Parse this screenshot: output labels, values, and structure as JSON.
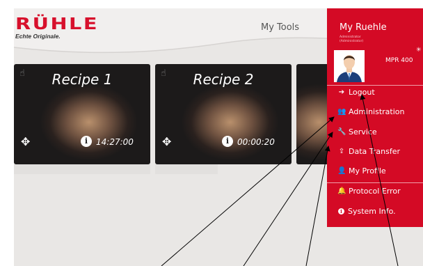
{
  "brand": {
    "name": "RÜHLE",
    "tagline": "Echte Originale."
  },
  "header": {
    "title": "My Tools"
  },
  "recipes": [
    {
      "name": "Recipe 1",
      "time": "14:27:00"
    },
    {
      "name": "Recipe 2",
      "time": "00:00:20"
    }
  ],
  "menu": {
    "user_name": "My Ruehle",
    "role_line1": "Administrator",
    "role_line2": "(Administrator)",
    "machine": "MPR 400",
    "items": [
      {
        "label": "Logout",
        "icon": "logout-icon"
      },
      {
        "label": "Administration",
        "icon": "users-icon"
      },
      {
        "label": "Service",
        "icon": "wrench-icon"
      },
      {
        "label": "Data Transfer",
        "icon": "upload-icon"
      },
      {
        "label": "My Profile",
        "icon": "user-icon"
      },
      {
        "label": "Protocol Error",
        "icon": "bell-icon"
      },
      {
        "label": "System Info.",
        "icon": "info-icon"
      }
    ]
  },
  "colors": {
    "accent": "#d40a25",
    "background": "#e9e7e5"
  }
}
